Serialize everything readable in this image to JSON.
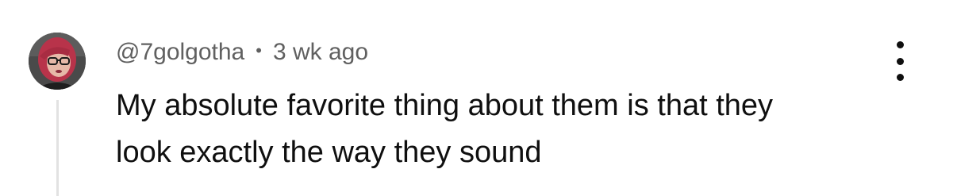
{
  "comment": {
    "author": "@7golgotha",
    "separator": "•",
    "timestamp": "3 wk ago",
    "text_lines": [
      "My absolute favorite thing about them is that they",
      "look exactly the way they sound"
    ]
  },
  "icons": {
    "avatar": "user-avatar-photo",
    "more": "vertical-ellipsis-icon"
  },
  "colors": {
    "meta_text": "#606060",
    "body_text": "#0f0f0f",
    "thread_line": "#e2e2e2",
    "avatar_hair": "#c0394b"
  }
}
